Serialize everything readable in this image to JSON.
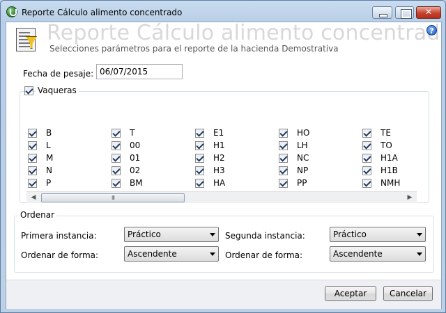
{
  "window": {
    "title": "Reporte Cálculo alimento concentrado"
  },
  "header": {
    "big_title": "Reporte Cálculo alimento concentrado",
    "subtitle": "Selecciones parámetros para el reporte de la hacienda Demostrativa",
    "help_glyph": "?"
  },
  "weigh": {
    "label": "Fecha de pesaje:",
    "value": "06/07/2015"
  },
  "cows": {
    "label": "Vaqueras",
    "checked": true,
    "columns": [
      [
        "B",
        "L",
        "M",
        "N",
        "P"
      ],
      [
        "T",
        "00",
        "01",
        "02",
        "BM"
      ],
      [
        "E1",
        "H1",
        "H2",
        "H3",
        "HA"
      ],
      [
        "HO",
        "LH",
        "NC",
        "NP",
        "PP"
      ],
      [
        "TE",
        "TO",
        "H1A",
        "H1B",
        "NMH"
      ]
    ],
    "scroll_thumb_glyph": "III"
  },
  "sort": {
    "group_label": "Ordenar",
    "first_label": "Primera instancia:",
    "first_value": "Práctico",
    "second_label": "Segunda instancia:",
    "second_value": "Práctico",
    "order1_label": "Ordenar de forma:",
    "order1_value": "Ascendente",
    "order2_label": "Ordenar de forma:",
    "order2_value": "Ascendente"
  },
  "buttons": {
    "accept": "Aceptar",
    "cancel": "Cancelar"
  },
  "colors": {
    "frame": "#bcd0e6",
    "big_title_text": "#d8d8d8",
    "close_button": "#c7432f"
  }
}
